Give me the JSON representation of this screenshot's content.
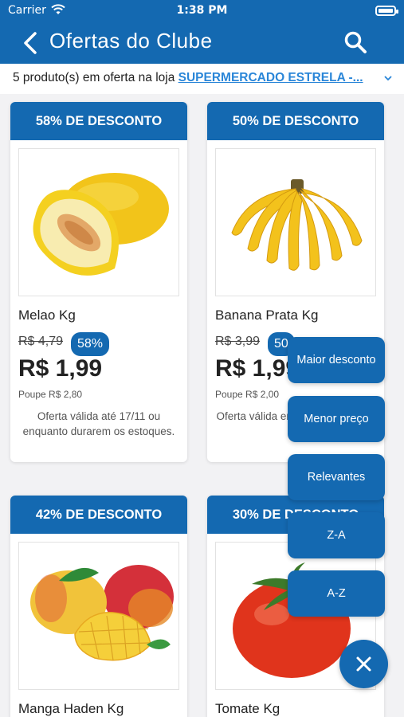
{
  "status": {
    "carrier": "Carrier",
    "time": "1:38 PM"
  },
  "nav": {
    "title": "Ofertas do Clube",
    "back_icon": "chevron-left-icon",
    "search_icon": "search-icon"
  },
  "info": {
    "prefix": "5 produto(s) em oferta na loja ",
    "store": "SUPERMERCADO ESTRELA -...",
    "chevron_icon": "chevron-down-icon"
  },
  "products": [
    {
      "badge": "58% DE DESCONTO",
      "name": "Melao Kg",
      "old_price": "R$ 4,79",
      "pct": "58%",
      "price": "R$ 1,99",
      "save": "Poupe R$ 2,80",
      "valid": "Oferta válida até 17/11 ou enquanto durarem os estoques."
    },
    {
      "badge": "50% DE DESCONTO",
      "name": "Banana Prata Kg",
      "old_price": "R$ 3,99",
      "pct": "50",
      "price": "R$ 1,99",
      "save": "Poupe R$ 2,00",
      "valid": "Oferta válida enquanto estoques."
    },
    {
      "badge": "42% DE DESCONTO",
      "name": "Manga Haden Kg"
    },
    {
      "badge": "30% DE DESCONTO",
      "name": "Tomate Kg"
    }
  ],
  "sort_menu": [
    "Maior desconto",
    "Menor preço",
    "Relevantes",
    "Z-A",
    "A-Z"
  ],
  "fab": {
    "icon": "close-icon"
  },
  "colors": {
    "primary": "#1469b1",
    "link": "#2a86d8",
    "background": "#f2f2f4"
  }
}
